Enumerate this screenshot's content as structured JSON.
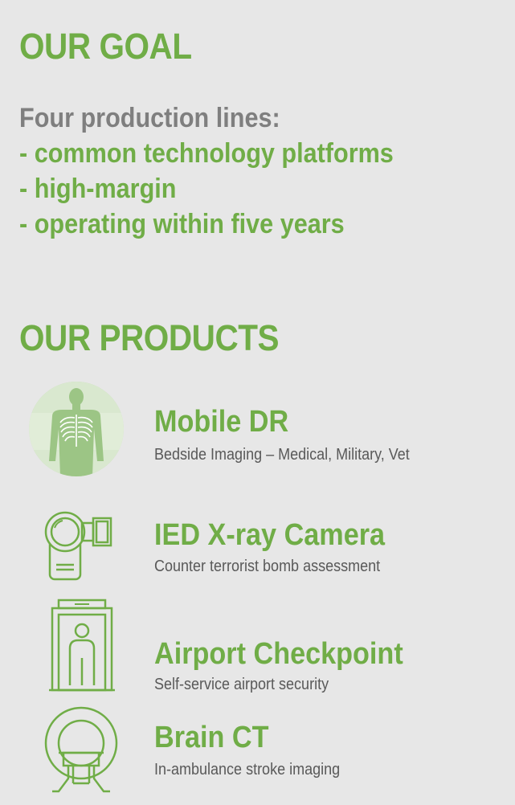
{
  "goal": {
    "title": "OUR GOAL",
    "intro": "Four production lines:",
    "bullets": [
      "- common technology platforms",
      "- high-margin",
      "- operating within five years"
    ]
  },
  "products": {
    "title": "OUR PRODUCTS",
    "items": [
      {
        "name": "Mobile DR",
        "description": "Bedside Imaging – Medical, Military, Vet",
        "icon": "chest-xray-icon"
      },
      {
        "name": "IED X-ray Camera",
        "description": "Counter terrorist bomb assessment",
        "icon": "camera-icon"
      },
      {
        "name": "Airport Checkpoint",
        "description": "Self-service airport security",
        "icon": "body-scanner-icon"
      },
      {
        "name": "Brain CT",
        "description": "In-ambulance stroke imaging",
        "icon": "ct-scanner-icon"
      }
    ]
  },
  "colors": {
    "accent": "#70ad47",
    "intro_text": "#7f7f7f",
    "body_text": "#595959",
    "background": "#e7e7e7"
  }
}
